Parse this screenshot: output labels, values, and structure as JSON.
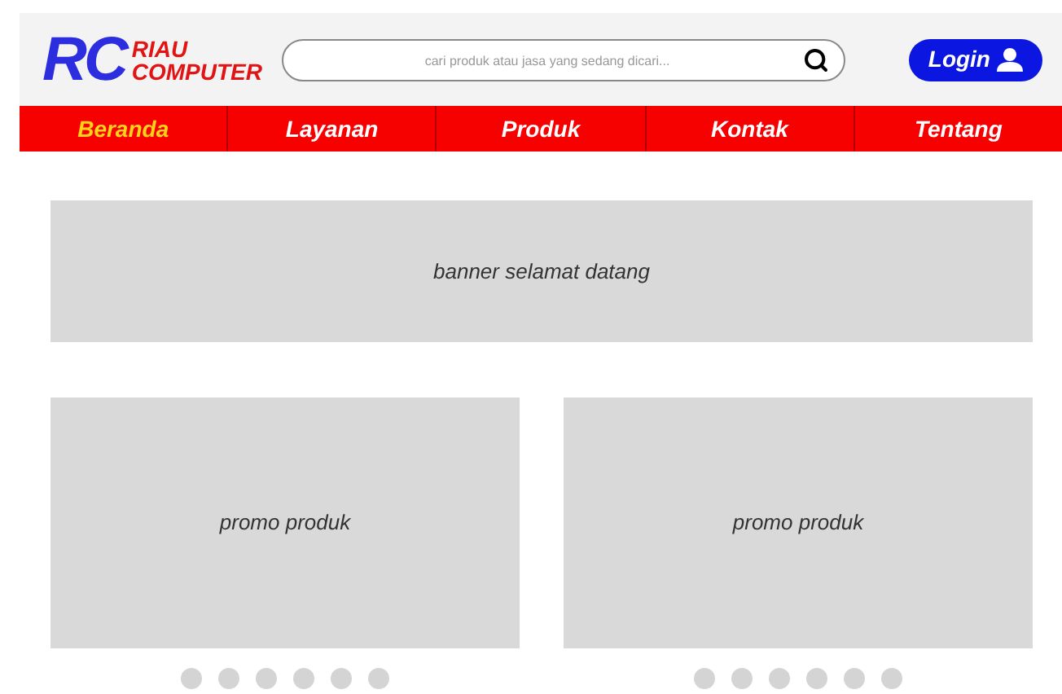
{
  "logo": {
    "mark": "RC",
    "line_1": "RIAU",
    "line_2": "COMPUTER"
  },
  "search": {
    "placeholder": "cari produk atau jasa yang sedang dicari..."
  },
  "login_button": {
    "label": "Login"
  },
  "nav": [
    {
      "label": "Beranda",
      "selected": true
    },
    {
      "label": "Layanan",
      "selected": false
    },
    {
      "label": "Produk",
      "selected": false
    },
    {
      "label": "Kontak",
      "selected": false
    },
    {
      "label": "Tentang",
      "selected": false
    }
  ],
  "banner": {
    "text": "banner selamat datang"
  },
  "promos": [
    {
      "text": "promo produk"
    },
    {
      "text": "promo produk"
    }
  ]
}
